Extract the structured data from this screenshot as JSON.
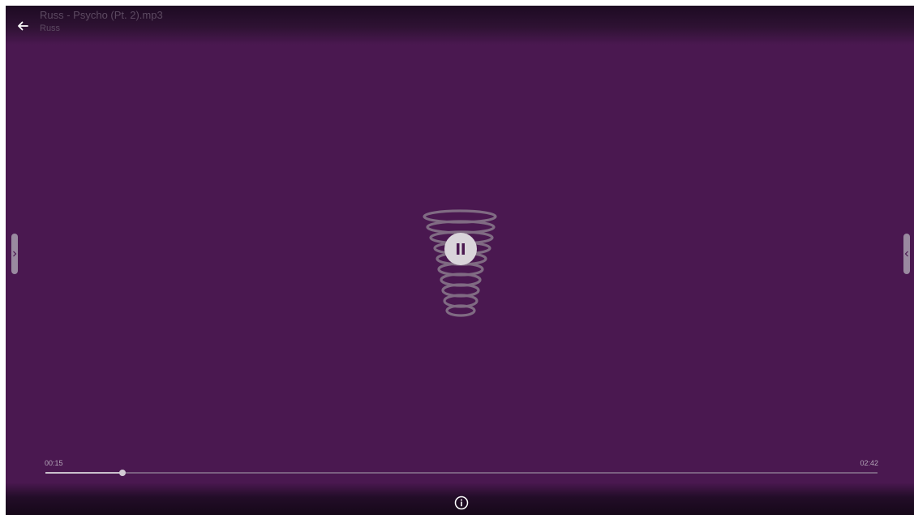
{
  "header": {
    "title": "Russ - Psycho (Pt. 2).mp3",
    "subtitle": "Russ",
    "back_icon": "arrow-left-icon"
  },
  "player": {
    "state_icon": "pause-icon",
    "elapsed": "00:15",
    "duration": "02:42",
    "progress": 0.093
  },
  "side_handles": {
    "left_icon": "chevron-right-icon",
    "right_icon": "chevron-left-icon"
  },
  "footer": {
    "info_icon": "info-icon"
  },
  "colors": {
    "background": "#4a1850",
    "accent": "#d9d4da"
  }
}
